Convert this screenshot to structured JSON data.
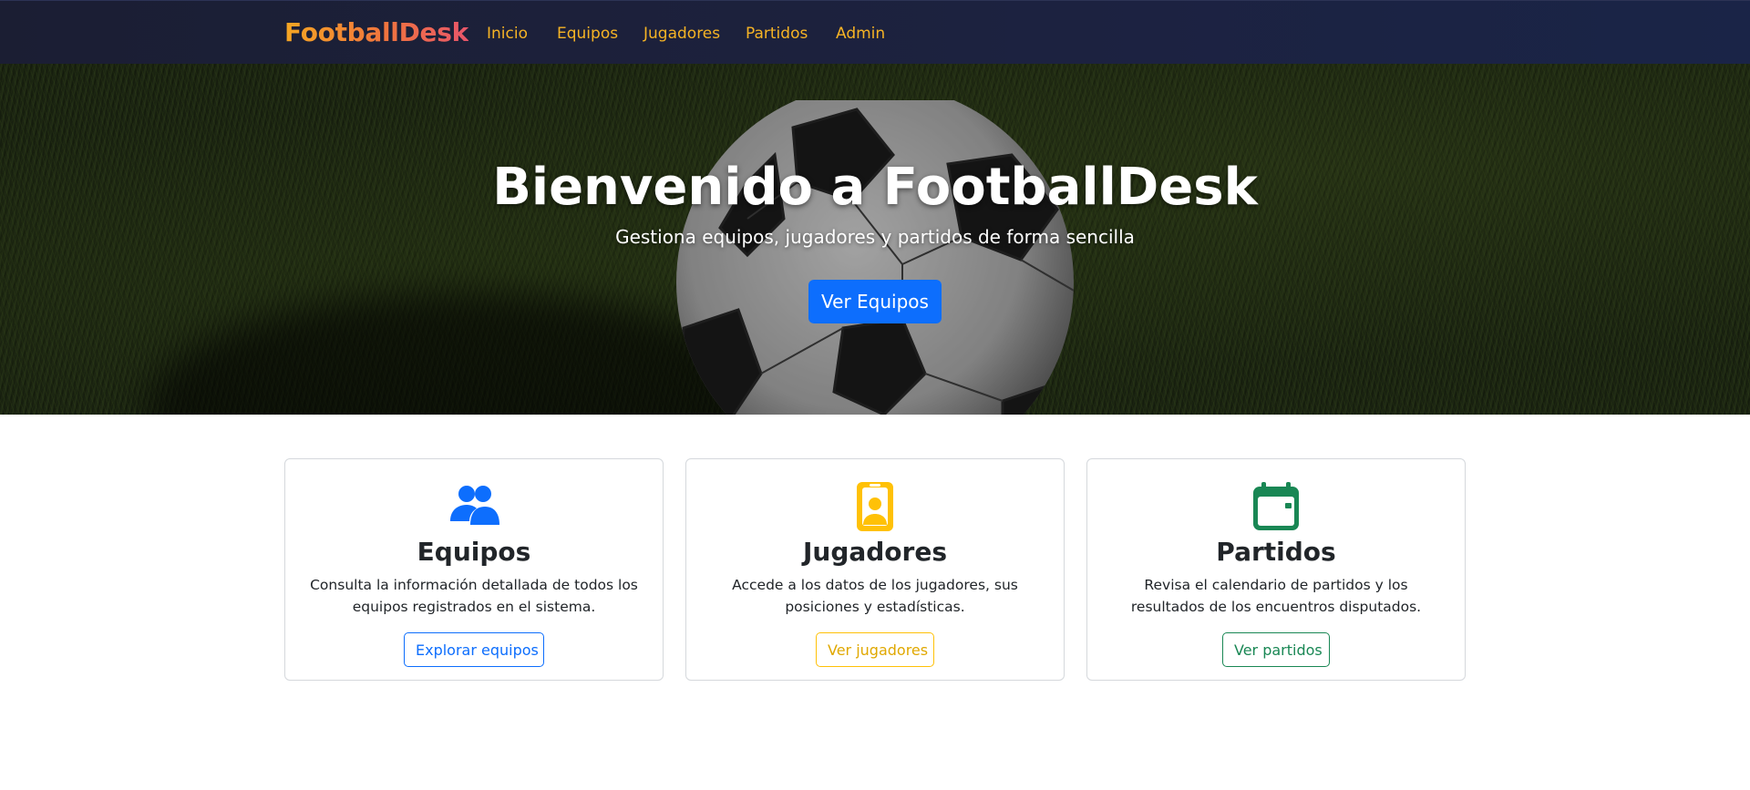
{
  "navbar": {
    "brand": "FootballDesk",
    "links": [
      "Inicio",
      "Equipos",
      "Jugadores",
      "Partidos",
      "Admin"
    ]
  },
  "hero": {
    "title": "Bienvenido a FootballDesk",
    "subtitle": "Gestiona equipos, jugadores y partidos de forma sencilla",
    "button": "Ver Equipos"
  },
  "cards": [
    {
      "icon": "people-icon",
      "title": "Equipos",
      "text": "Consulta la información detallada de todos los equipos registrados en el sistema.",
      "button": "Explorar equipos",
      "color": "#0d6efd"
    },
    {
      "icon": "player-badge-icon",
      "title": "Jugadores",
      "text": "Accede a los datos de los jugadores, sus posiciones y estadísticas.",
      "button": "Ver jugadores",
      "color": "#ffc107"
    },
    {
      "icon": "calendar-icon",
      "title": "Partidos",
      "text": "Revisa el calendario de partidos y los resultados de los encuentros disputados.",
      "button": "Ver partidos",
      "color": "#198754"
    }
  ],
  "colors": {
    "navbar_bg": "#1c2240",
    "nav_link": "#f6b325",
    "primary": "#0d6efd"
  }
}
